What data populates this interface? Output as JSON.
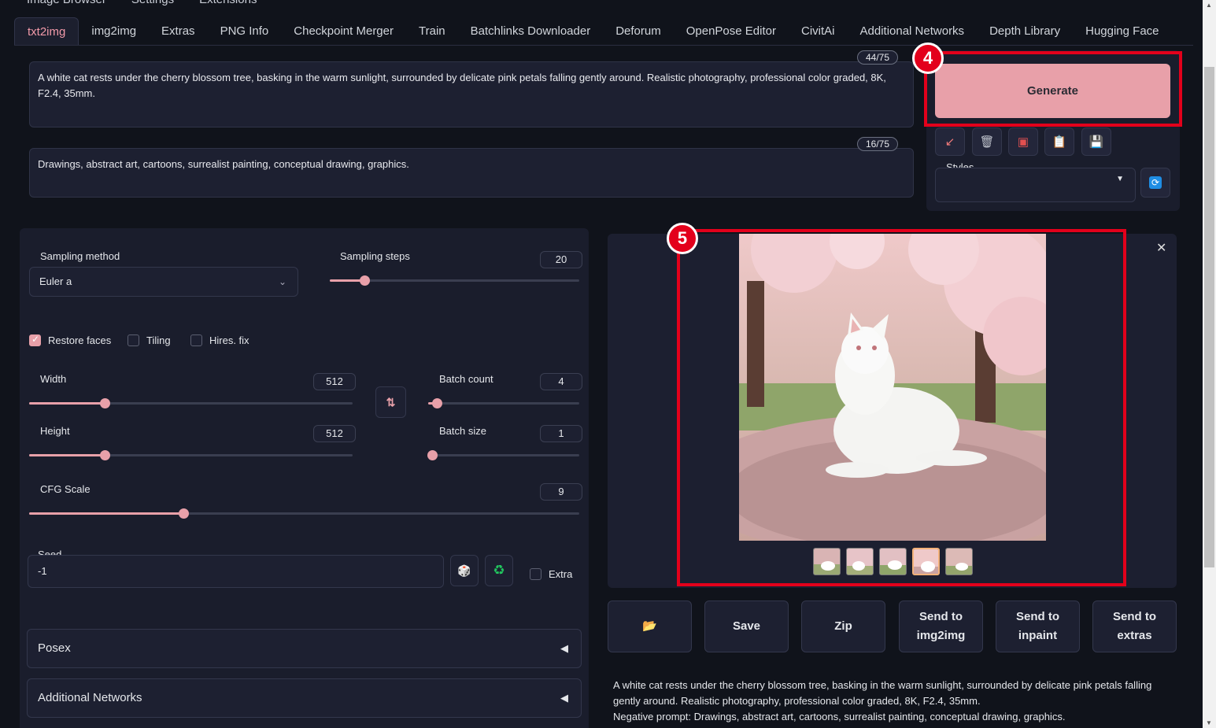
{
  "top_tabs": [
    "Image Browser",
    "Settings",
    "Extensions"
  ],
  "tabs": [
    "txt2img",
    "img2img",
    "Extras",
    "PNG Info",
    "Checkpoint Merger",
    "Train",
    "Batchlinks Downloader",
    "Deforum",
    "OpenPose Editor",
    "CivitAi",
    "Additional Networks",
    "Depth Library",
    "Hugging Face"
  ],
  "prompt": {
    "positive": "A white cat rests under the cherry blossom tree, basking in the warm sunlight, surrounded by delicate pink petals falling gently around. Realistic photography, professional color graded, 8K, F2.4, 35mm.",
    "positive_count": "44/75",
    "negative": "Drawings, abstract art, cartoons, surrealist painting, conceptual drawing, graphics.",
    "negative_count": "16/75"
  },
  "generate_label": "Generate",
  "annotations": {
    "badge4": "4",
    "badge5": "5"
  },
  "tool_icons": [
    "arrow-icon",
    "trash-icon",
    "card-icon",
    "clipboard-icon",
    "save-icon"
  ],
  "styles_label": "Styles",
  "sampling": {
    "method_label": "Sampling method",
    "method_value": "Euler a",
    "steps_label": "Sampling steps",
    "steps_value": "20"
  },
  "checkboxes": {
    "restore_faces": "Restore faces",
    "tiling": "Tiling",
    "hires": "Hires. fix"
  },
  "width": {
    "label": "Width",
    "value": "512"
  },
  "height": {
    "label": "Height",
    "value": "512"
  },
  "batch_count": {
    "label": "Batch count",
    "value": "4"
  },
  "batch_size": {
    "label": "Batch size",
    "value": "1"
  },
  "cfg": {
    "label": "CFG Scale",
    "value": "9"
  },
  "seed": {
    "label": "Seed",
    "value": "-1",
    "extra_label": "Extra"
  },
  "accordions": {
    "posex": "Posex",
    "networks": "Additional Networks"
  },
  "actions": {
    "save": "Save",
    "zip": "Zip",
    "send_img2img": "Send to img2img",
    "send_inpaint": "Send to inpaint",
    "send_extras": "Send to extras"
  },
  "info": {
    "line1": "A white cat rests under the cherry blossom tree, basking in the warm sunlight, surrounded by delicate pink petals falling gently around. Realistic photography, professional color graded, 8K, F2.4, 35mm.",
    "line2": "Negative prompt: Drawings, abstract art, cartoons, surrealist painting, conceptual drawing, graphics."
  },
  "colors": {
    "accent": "#e8a0a9",
    "annotation_red": "#e3001b"
  }
}
